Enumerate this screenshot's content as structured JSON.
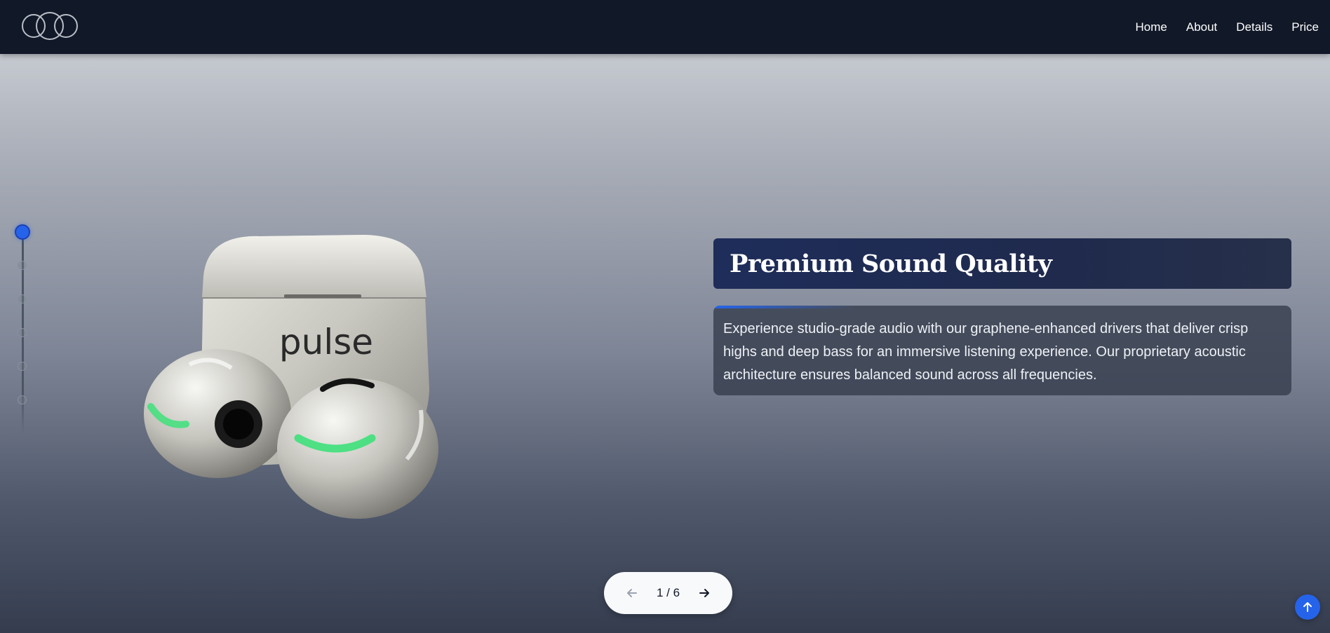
{
  "header": {
    "logo_name": "triple-ring-logo",
    "nav": [
      {
        "label": "Home"
      },
      {
        "label": "About"
      },
      {
        "label": "Details"
      },
      {
        "label": "Price"
      }
    ]
  },
  "slider": {
    "steps_total": 6,
    "active_step": 1,
    "title": "Premium Sound Quality",
    "description": "Experience studio-grade audio with our graphene-enhanced drivers that deliver crisp highs and deep bass for an immersive listening experience. Our proprietary acoustic architecture ensures balanced sound across all frequencies.",
    "product_brand_print": "pulse",
    "pager_text": "1 / 6",
    "prev_icon": "arrow-left-icon",
    "next_icon": "arrow-right-icon"
  },
  "scroll_top_icon": "arrow-up-icon",
  "colors": {
    "topbar": "#111827",
    "accent": "#2563eb",
    "title_box": "#1e2d5a",
    "led_green": "#3ee07a"
  }
}
